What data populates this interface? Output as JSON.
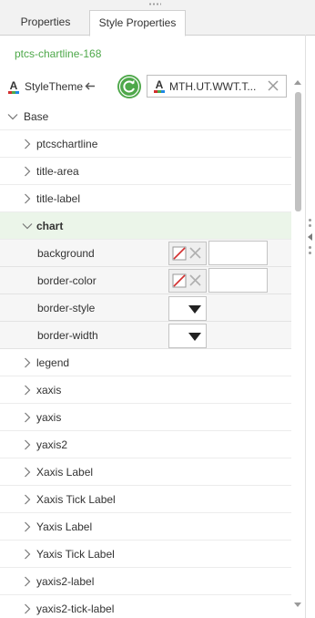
{
  "tabs": [
    {
      "label": "Properties",
      "active": false
    },
    {
      "label": "Style Properties",
      "active": true
    }
  ],
  "widget_name": "ptcs-chartline-168",
  "style_theme": {
    "label": "StyleTheme",
    "value": "MTH.UT.WWT.T...",
    "icons": [
      "style-theme-icon",
      "link-icon",
      "refresh-icon",
      "clear-icon"
    ]
  },
  "tree": {
    "root": {
      "label": "Base",
      "expanded": true
    },
    "items_before": [
      "ptcschartline",
      "title-area",
      "title-label"
    ],
    "selected": {
      "label": "chart",
      "expanded": true
    },
    "properties": [
      {
        "label": "background",
        "control": "color",
        "value": ""
      },
      {
        "label": "border-color",
        "control": "color",
        "value": ""
      },
      {
        "label": "border-style",
        "control": "select",
        "value": ""
      },
      {
        "label": "border-width",
        "control": "select",
        "value": ""
      }
    ],
    "items_after": [
      "legend",
      "xaxis",
      "yaxis",
      "yaxis2",
      "Xaxis Label",
      "Xaxis Tick Label",
      "Yaxis Label",
      "Yaxis Tick Label",
      "yaxis2-label",
      "yaxis2-tick-label"
    ]
  },
  "colors": {
    "accent_green": "#4ea84a",
    "selected_bg": "#ebf5e9",
    "no_color_slash": "#d32f2f"
  }
}
